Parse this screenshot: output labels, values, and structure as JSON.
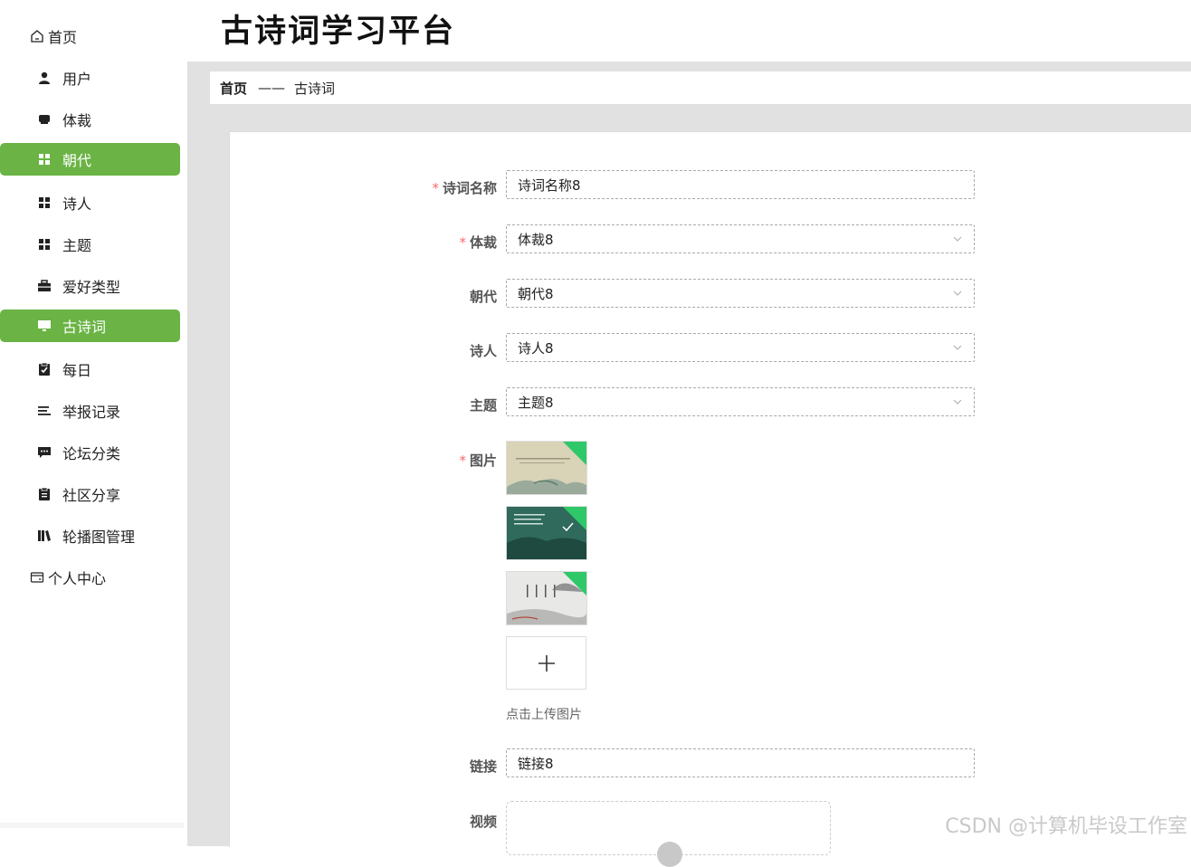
{
  "app": {
    "title": "古诗词学习平台"
  },
  "sidebar": {
    "items": [
      {
        "label": "首页",
        "icon": "home-icon",
        "level": "top",
        "active": false
      },
      {
        "label": "用户",
        "icon": "user-icon",
        "level": "sub",
        "active": false
      },
      {
        "label": "体裁",
        "icon": "monitor-icon",
        "level": "sub",
        "active": false
      },
      {
        "label": "朝代",
        "icon": "grid-icon",
        "level": "sub",
        "active": true
      },
      {
        "label": "诗人",
        "icon": "grid-icon",
        "level": "sub",
        "active": false
      },
      {
        "label": "主题",
        "icon": "grid-icon",
        "level": "sub",
        "active": false
      },
      {
        "label": "爱好类型",
        "icon": "briefcase-icon",
        "level": "sub",
        "active": false
      },
      {
        "label": "古诗词",
        "icon": "desktop-icon",
        "level": "sub",
        "active": true
      },
      {
        "label": "每日",
        "icon": "clipboard-check-icon",
        "level": "sub",
        "active": false
      },
      {
        "label": "举报记录",
        "icon": "list-icon",
        "level": "sub",
        "active": false
      },
      {
        "label": "论坛分类",
        "icon": "chat-icon",
        "level": "sub",
        "active": false
      },
      {
        "label": "社区分享",
        "icon": "clipboard-icon",
        "level": "sub",
        "active": false
      },
      {
        "label": "轮播图管理",
        "icon": "library-icon",
        "level": "sub",
        "active": false
      },
      {
        "label": "个人中心",
        "icon": "wallet-icon",
        "level": "top",
        "active": false
      }
    ]
  },
  "breadcrumb": {
    "home": "首页",
    "separator": "——",
    "current": "古诗词"
  },
  "form": {
    "name": {
      "label": "诗词名称",
      "required": true,
      "value": "诗词名称8"
    },
    "genre": {
      "label": "体裁",
      "required": true,
      "value": "体裁8"
    },
    "dynasty": {
      "label": "朝代",
      "required": false,
      "value": "朝代8"
    },
    "poet": {
      "label": "诗人",
      "required": false,
      "value": "诗人8"
    },
    "theme": {
      "label": "主题",
      "required": false,
      "value": "主题8"
    },
    "images": {
      "label": "图片",
      "required": true,
      "hint": "点击上传图片",
      "count": 3
    },
    "link": {
      "label": "链接",
      "required": false,
      "value": "链接8"
    },
    "video": {
      "label": "视频",
      "required": false
    }
  },
  "watermark": "CSDN @计算机毕设工作室",
  "colors": {
    "accent": "#6ab344",
    "required": "#f56c6c",
    "upload_badge": "#2ec868"
  }
}
